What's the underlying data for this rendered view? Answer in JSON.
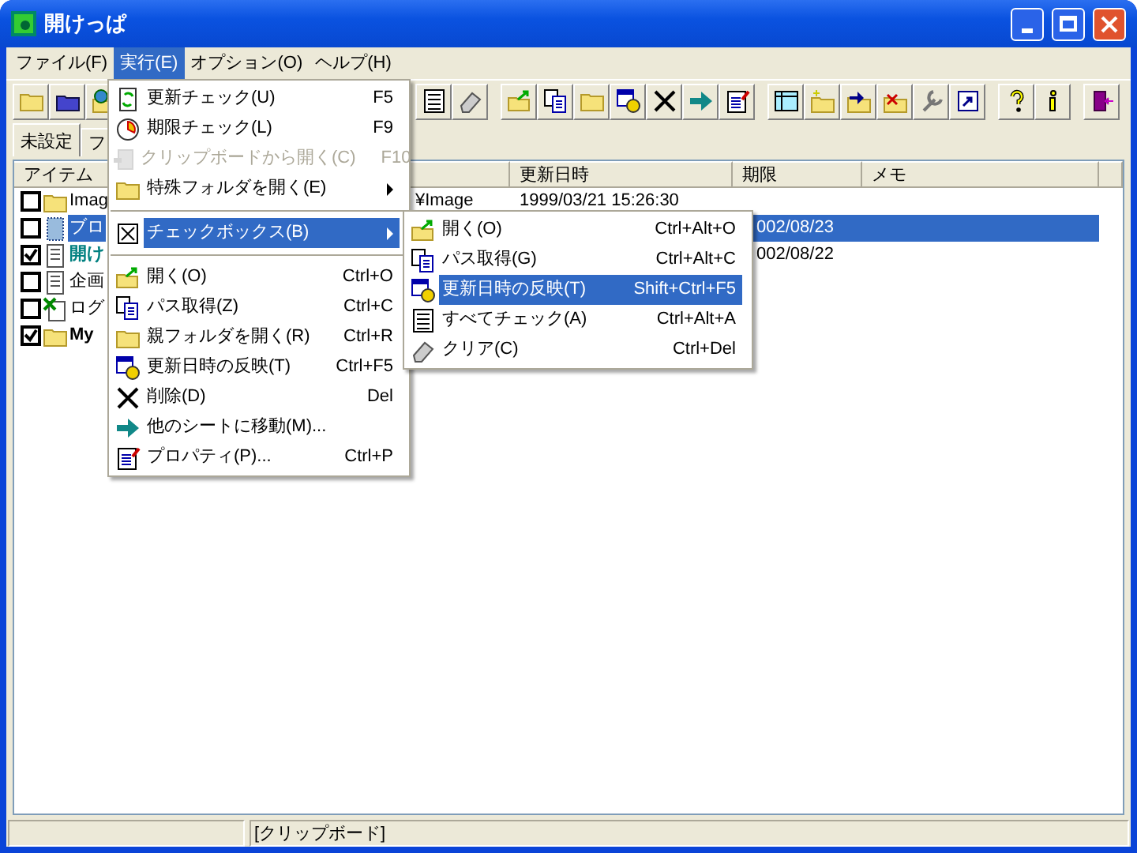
{
  "window": {
    "title": "開けっぱ"
  },
  "menu_bar": [
    {
      "label": "ファイル(F)",
      "selected": false
    },
    {
      "label": "実行(E)",
      "selected": true
    },
    {
      "label": "オプション(O)",
      "selected": false
    },
    {
      "label": "ヘルプ(H)",
      "selected": false
    }
  ],
  "tabs": [
    {
      "label": "未設定",
      "selected": true
    },
    {
      "label": "フ",
      "selected": false
    }
  ],
  "table": {
    "columns": [
      "アイテム",
      "更新日時",
      "期限",
      "メモ"
    ],
    "rows": [
      {
        "checked": false,
        "kind": "folder",
        "name": "Imag",
        "color": "#000000",
        "bold": false,
        "column_2": "¥Image",
        "updated": "1999/03/21 15:26:30",
        "selected": false
      },
      {
        "checked": false,
        "kind": "file",
        "name": "ブロ",
        "bold": false,
        "deadline": "002/08/23",
        "selected": true
      },
      {
        "checked": true,
        "kind": "note",
        "name": "開け",
        "color": "#008080",
        "bold": true,
        "deadline": "002/08/22",
        "selected": false
      },
      {
        "checked": false,
        "kind": "note",
        "name": "企画",
        "color": "#000000",
        "bold": false,
        "selected": false
      },
      {
        "checked": false,
        "kind": "sheet",
        "name": "ログ",
        "color": "#000000",
        "bold": false,
        "selected": false
      },
      {
        "checked": true,
        "kind": "folder",
        "name": "My",
        "color": "#000000",
        "bold": true,
        "selected": false
      }
    ]
  },
  "run_menu": {
    "items": [
      {
        "kind": "item",
        "label": "更新チェック(U)",
        "shortcut": "F5",
        "disabled": false,
        "selected": false,
        "submenu": false
      },
      {
        "kind": "item",
        "label": "期限チェック(L)",
        "shortcut": "F9",
        "disabled": false,
        "selected": false,
        "submenu": false
      },
      {
        "kind": "item",
        "label": "クリップボードから開く(C)",
        "shortcut": "F10",
        "disabled": true,
        "selected": false,
        "submenu": false
      },
      {
        "kind": "item",
        "label": "特殊フォルダを開く(E)",
        "disabled": false,
        "selected": false,
        "submenu": true
      },
      {
        "kind": "separator"
      },
      {
        "kind": "item",
        "label": "チェックボックス(B)",
        "disabled": false,
        "selected": true,
        "submenu": true
      },
      {
        "kind": "separator"
      },
      {
        "kind": "item",
        "label": "開く(O)",
        "shortcut": "Ctrl+O",
        "disabled": false,
        "selected": false,
        "submenu": false
      },
      {
        "kind": "item",
        "label": "パス取得(Z)",
        "shortcut": "Ctrl+C",
        "disabled": false,
        "selected": false,
        "submenu": false
      },
      {
        "kind": "item",
        "label": "親フォルダを開く(R)",
        "shortcut": "Ctrl+R",
        "disabled": false,
        "selected": false,
        "submenu": false
      },
      {
        "kind": "item",
        "label": "更新日時の反映(T)",
        "shortcut": "Ctrl+F5",
        "disabled": false,
        "selected": false,
        "submenu": false
      },
      {
        "kind": "item",
        "label": "削除(D)",
        "shortcut": "Del",
        "disabled": false,
        "selected": false,
        "submenu": false
      },
      {
        "kind": "item",
        "label": "他のシートに移動(M)...",
        "disabled": false,
        "selected": false,
        "submenu": false
      },
      {
        "kind": "item",
        "label": "プロパティ(P)...",
        "shortcut": "Ctrl+P",
        "disabled": false,
        "selected": false,
        "submenu": false
      }
    ]
  },
  "checkbox_submenu": {
    "items": [
      {
        "kind": "item",
        "label": "開く(O)",
        "shortcut": "Ctrl+Alt+O",
        "disabled": false,
        "selected": false,
        "submenu": false
      },
      {
        "kind": "item",
        "label": "パス取得(G)",
        "shortcut": "Ctrl+Alt+C",
        "disabled": false,
        "selected": false,
        "submenu": false
      },
      {
        "kind": "item",
        "label": "更新日時の反映(T)",
        "shortcut": "Shift+Ctrl+F5",
        "disabled": false,
        "selected": true,
        "submenu": false
      },
      {
        "kind": "item",
        "label": "すべてチェック(A)",
        "shortcut": "Ctrl+Alt+A",
        "disabled": false,
        "selected": false,
        "submenu": false
      },
      {
        "kind": "item",
        "label": "クリア(C)",
        "shortcut": "Ctrl+Del",
        "disabled": false,
        "selected": false,
        "submenu": false
      }
    ]
  },
  "status_bar": {
    "clipboard": "[クリップボード]"
  }
}
